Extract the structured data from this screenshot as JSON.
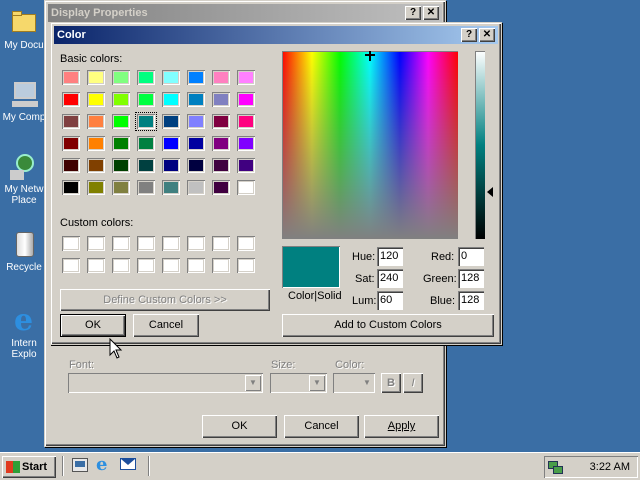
{
  "desktop": {
    "icons": [
      {
        "label": "My Docu",
        "icon": "folder-icon"
      },
      {
        "label": "My Comp",
        "icon": "computer-icon"
      },
      {
        "label": "My Netw Place",
        "icon": "network-icon"
      },
      {
        "label": "Recycle",
        "icon": "recycle-bin-icon"
      },
      {
        "label": "Intern Explo",
        "icon": "internet-explorer-icon"
      }
    ]
  },
  "display_properties": {
    "title": "Display Properties",
    "help_label": "?",
    "close_label": "✕",
    "font_label": "Font:",
    "size_label": "Size:",
    "color_label": "Color:",
    "bold_label": "B",
    "italic_label": "I",
    "ok_label": "OK",
    "cancel_label": "Cancel",
    "apply_label": "Apply"
  },
  "color_dialog": {
    "title": "Color",
    "help_label": "?",
    "close_label": "✕",
    "basic_colors_label": "Basic colors:",
    "custom_colors_label": "Custom colors:",
    "define_custom_label": "Define Custom Colors >>",
    "ok_label": "OK",
    "cancel_label": "Cancel",
    "add_custom_label": "Add to Custom Colors",
    "color_solid_label": "Color|Solid",
    "hue_label": "Hue:",
    "sat_label": "Sat:",
    "lum_label": "Lum:",
    "red_label": "Red:",
    "green_label": "Green:",
    "blue_label": "Blue:",
    "hue": "120",
    "sat": "240",
    "lum": "60",
    "red": "0",
    "green": "128",
    "blue": "128",
    "selected_color": "#008080",
    "basic_colors": [
      [
        "#ff8080",
        "#ffff80",
        "#80ff80",
        "#00ff80",
        "#80ffff",
        "#0080ff",
        "#ff80c0",
        "#ff80ff"
      ],
      [
        "#ff0000",
        "#ffff00",
        "#80ff00",
        "#00ff40",
        "#00ffff",
        "#0080c0",
        "#8080c0",
        "#ff00ff"
      ],
      [
        "#804040",
        "#ff8040",
        "#00ff00",
        "#008080",
        "#004080",
        "#8080ff",
        "#800040",
        "#ff0080"
      ],
      [
        "#800000",
        "#ff8000",
        "#008000",
        "#008040",
        "#0000ff",
        "#0000a0",
        "#800080",
        "#8000ff"
      ],
      [
        "#400000",
        "#804000",
        "#004000",
        "#004040",
        "#000080",
        "#000040",
        "#400040",
        "#400080"
      ],
      [
        "#000000",
        "#808000",
        "#808040",
        "#808080",
        "#408080",
        "#c0c0c0",
        "#400040",
        "#ffffff"
      ]
    ],
    "selected_basic_index": [
      2,
      3
    ],
    "custom_colors": [
      [
        "#ffffff",
        "#ffffff",
        "#ffffff",
        "#ffffff",
        "#ffffff",
        "#ffffff",
        "#ffffff",
        "#ffffff"
      ],
      [
        "#ffffff",
        "#ffffff",
        "#ffffff",
        "#ffffff",
        "#ffffff",
        "#ffffff",
        "#ffffff",
        "#ffffff"
      ]
    ]
  },
  "taskbar": {
    "start_label": "Start",
    "clock": "3:22 AM",
    "quick_launch": [
      "show-desktop-icon",
      "internet-explorer-icon",
      "outlook-express-icon"
    ]
  }
}
